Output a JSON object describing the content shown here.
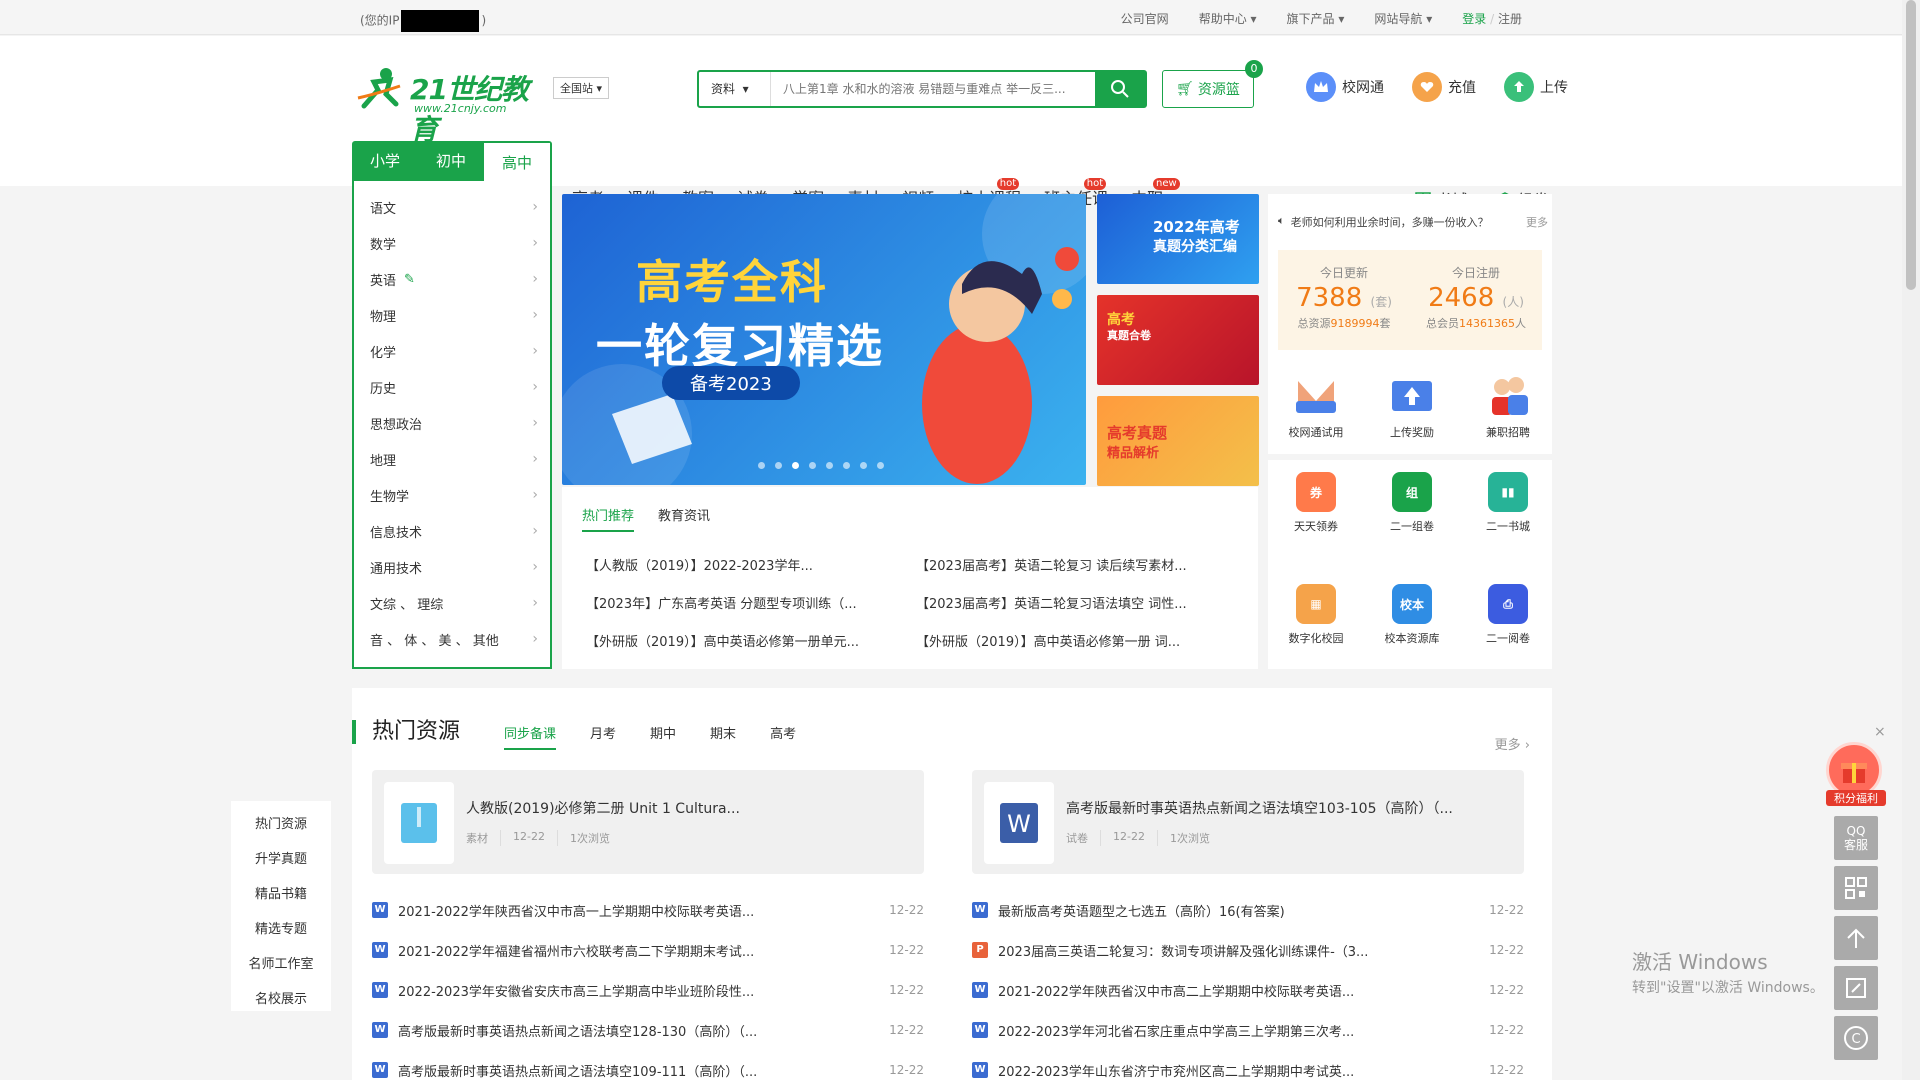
{
  "topbar": {
    "ip_prefix": "(您的IP",
    "ip_suffix": ")",
    "company": "公司官网",
    "help": "帮助中心",
    "products": "旗下产品",
    "sitenav": "网站导航",
    "login": "登录",
    "slash": "/",
    "register": "注册"
  },
  "header": {
    "logo_main": "21世纪教育",
    "logo_url": "www.21cnjy.com",
    "region": "全国站",
    "search_type": "资料",
    "search_placeholder": "八上第1章 水和水的溶液 易错题与重难点 举一反三...",
    "basket": "资源篮",
    "basket_count": "0",
    "xiaowangtong": "校网通",
    "recharge": "充值",
    "upload": "上传"
  },
  "levels": [
    "小学",
    "初中",
    "高中"
  ],
  "mainnav": [
    {
      "label": "高考",
      "tag": ""
    },
    {
      "label": "课件",
      "tag": ""
    },
    {
      "label": "教案",
      "tag": ""
    },
    {
      "label": "试卷",
      "tag": ""
    },
    {
      "label": "学案",
      "tag": ""
    },
    {
      "label": "素材",
      "tag": ""
    },
    {
      "label": "视频",
      "tag": ""
    },
    {
      "label": "校本课程",
      "tag": "hot"
    },
    {
      "label": "班主任课",
      "tag": "hot"
    },
    {
      "label": "中职",
      "tag": "new"
    }
  ],
  "rightnav": {
    "bookstore": "书城",
    "zujuan": "组卷"
  },
  "subjects": [
    "语文",
    "数学",
    "英语",
    "物理",
    "化学",
    "历史",
    "思想政治",
    "地理",
    "生物学",
    "信息技术",
    "通用技术",
    "文综 、 理综",
    "音 、 体 、 美 、 其他"
  ],
  "banner": {
    "line1": "高考全科",
    "line2": "一轮复习精选",
    "line3": "备考2023"
  },
  "promos": [
    {
      "title": "2022年高考",
      "sub": "真题分类汇编"
    },
    {
      "title": "高考",
      "sub": "真题合卷"
    },
    {
      "title": "高考真题",
      "sub": "精品解析"
    }
  ],
  "news": {
    "tabs": [
      "热门推荐",
      "教育资讯"
    ],
    "items": [
      "【人教版（2019）】2022-2023学年...",
      "【2023届高考】英语二轮复习 读后续写素材...",
      "【2023年】广东高考英语 分题型专项训练（...",
      "【2023届高考】英语二轮复习语法填空 词性...",
      "【外研版（2019）】高中英语必修第一册单元...",
      "【外研版（2019）】高中英语必修第一册 词..."
    ]
  },
  "side": {
    "notice": "老师如何利用业余时间，多赚一份收入？",
    "more": "更多",
    "today_update_label": "今日更新",
    "today_update": "7388",
    "update_unit": "(套)",
    "total_res_label": "总资源",
    "total_res": "9189994",
    "total_res_unit": "套",
    "today_reg_label": "今日注册",
    "today_reg": "2468",
    "reg_unit": "(人)",
    "total_mem_label": "总会员",
    "total_mem": "14361365",
    "total_mem_unit": "人",
    "row1": [
      "校网通试用",
      "上传奖励",
      "兼职招聘"
    ],
    "row2": [
      "天天领券",
      "二一组卷",
      "二一书城"
    ],
    "row3": [
      "数字化校园",
      "校本资源库",
      "二一阅卷"
    ]
  },
  "hot": {
    "title": "热门资源",
    "tabs": [
      "同步备课",
      "月考",
      "期中",
      "期末",
      "高考"
    ],
    "more": "更多",
    "card_left": {
      "title": "人教版(2019)必修第二册 Unit 1 Cultura...",
      "type": "素材",
      "date": "12-22",
      "views": "1次浏览"
    },
    "card_right": {
      "title": "高考版最新时事英语热点新闻之语法填空103-105（高阶）（...",
      "type": "试卷",
      "date": "12-22",
      "views": "1次浏览"
    },
    "left_list": [
      {
        "t": "2021-2022学年陕西省汉中市高一上学期期中校际联考英语...",
        "d": "12-22",
        "f": "W"
      },
      {
        "t": "2021-2022学年福建省福州市六校联考高二下学期期末考试...",
        "d": "12-22",
        "f": "W"
      },
      {
        "t": "2022-2023学年安徽省安庆市高三上学期高中毕业班阶段性...",
        "d": "12-22",
        "f": "W"
      },
      {
        "t": "高考版最新时事英语热点新闻之语法填空128-130（高阶）（...",
        "d": "12-22",
        "f": "W"
      },
      {
        "t": "高考版最新时事英语热点新闻之语法填空109-111（高阶）（...",
        "d": "12-22",
        "f": "W"
      }
    ],
    "right_list": [
      {
        "t": "最新版高考英语题型之七选五（高阶）16(有答案)",
        "d": "12-22",
        "f": "W"
      },
      {
        "t": "2023届高三英语二轮复习：数词专项讲解及强化训练课件-（3...",
        "d": "12-22",
        "f": "P"
      },
      {
        "t": "2021-2022学年陕西省汉中市高二上学期期中校际联考英语...",
        "d": "12-22",
        "f": "W"
      },
      {
        "t": "2022-2023学年河北省石家庄重点中学高三上学期第三次考...",
        "d": "12-22",
        "f": "W"
      },
      {
        "t": "2022-2023学年山东省济宁市兖州区高二上学期期中考试英...",
        "d": "12-22",
        "f": "W"
      }
    ]
  },
  "leftmenu": [
    "热门资源",
    "升学真题",
    "精品书籍",
    "精选专题",
    "名师工作室",
    "名校展示"
  ],
  "float": {
    "gift": "积分福利",
    "qq": "QQ\n客服",
    "close": "×"
  },
  "watermark": {
    "line1": "激活 Windows",
    "line2": "转到\"设置\"以激活 Windows。"
  },
  "colors": {
    "brand": "#1aa34a",
    "hot": "#e53b2c",
    "orange": "#f07b16"
  }
}
